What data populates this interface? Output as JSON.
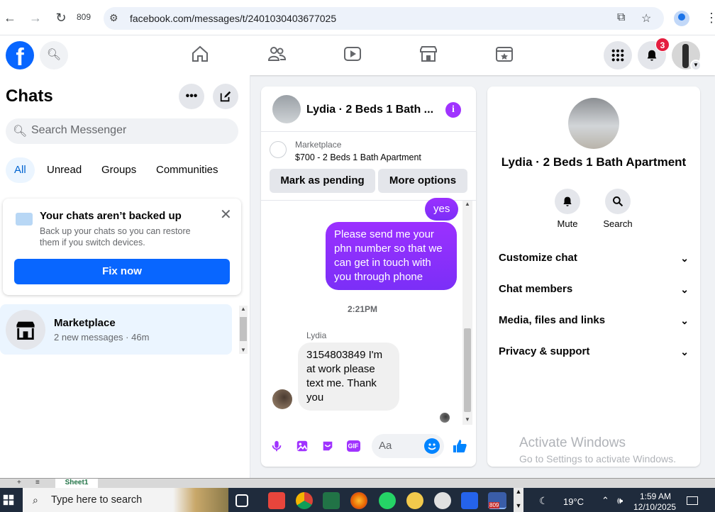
{
  "browser": {
    "tab_count": "809",
    "url": "facebook.com/messages/t/2401030403677025"
  },
  "fbnav": {
    "logo_letter": "f",
    "notification_count": "3"
  },
  "sidebar": {
    "title": "Chats",
    "search_placeholder": "Search Messenger",
    "filters": [
      "All",
      "Unread",
      "Groups",
      "Communities"
    ],
    "backup": {
      "title": "Your chats aren’t backed up",
      "description": "Back up your chats so you can restore them if you switch devices.",
      "button": "Fix now"
    },
    "conversation": {
      "name": "Marketplace",
      "preview": "2 new messages · 46m"
    }
  },
  "conversation": {
    "header_name": "Lydia · 2 Beds 1 Bath ...",
    "marketplace_label": "Marketplace",
    "listing": "$700 - 2 Beds 1 Bath Apartment",
    "buttons": {
      "mark_pending": "Mark as pending",
      "more_options": "More options"
    },
    "messages": {
      "out_yes": "yes",
      "out_request": "Please send me your phn number so that we can get in touch with you through phone",
      "timestamp": "2:21PM",
      "sender": "Lydia",
      "in_reply": "3154803849 I'm at work please text me. Thank you"
    },
    "composer": {
      "placeholder": "Aa",
      "gif_label": "GIF"
    }
  },
  "details": {
    "name": "Lydia · 2 Beds 1 Bath Apartment",
    "actions": [
      "Mute",
      "Search"
    ],
    "sections": [
      "Customize chat",
      "Chat members",
      "Media, files and links",
      "Privacy & support"
    ],
    "watermark_title": "Activate Windows",
    "watermark_sub": "Go to Settings to activate Windows."
  },
  "excel": {
    "sheet": "Sheet1"
  },
  "taskbar": {
    "search_placeholder": "Type here to search",
    "temperature": "19°C",
    "time": "1:59 AM",
    "date": "12/10/2025",
    "app_badge": "809"
  },
  "colors": {
    "facebook_blue": "#0866ff",
    "messenger_purple": "#a033ff",
    "notification_red": "#e41e3f",
    "taskbar": "#1f2b3c"
  }
}
